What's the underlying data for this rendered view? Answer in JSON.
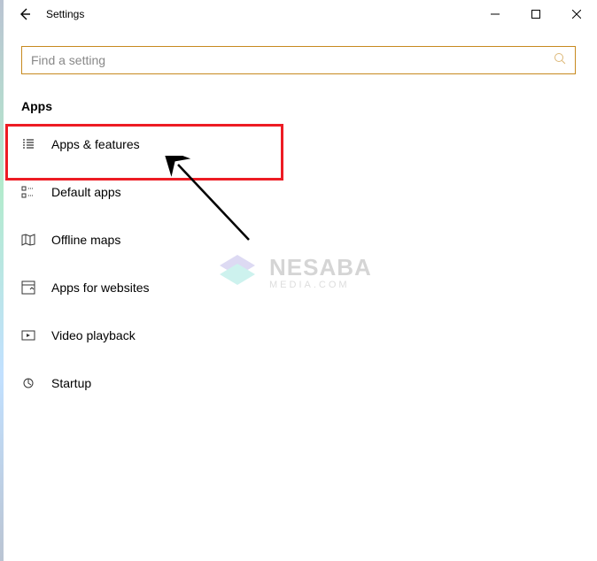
{
  "window": {
    "title": "Settings"
  },
  "search": {
    "placeholder": "Find a setting"
  },
  "section": {
    "heading": "Apps"
  },
  "nav": {
    "items": [
      {
        "label": "Apps & features",
        "icon": "apps-features-icon"
      },
      {
        "label": "Default apps",
        "icon": "default-apps-icon"
      },
      {
        "label": "Offline maps",
        "icon": "offline-maps-icon"
      },
      {
        "label": "Apps for websites",
        "icon": "apps-websites-icon"
      },
      {
        "label": "Video playback",
        "icon": "video-playback-icon"
      },
      {
        "label": "Startup",
        "icon": "startup-icon"
      }
    ]
  },
  "watermark": {
    "brand": "NESABA",
    "sub": "MEDIA.COM"
  }
}
